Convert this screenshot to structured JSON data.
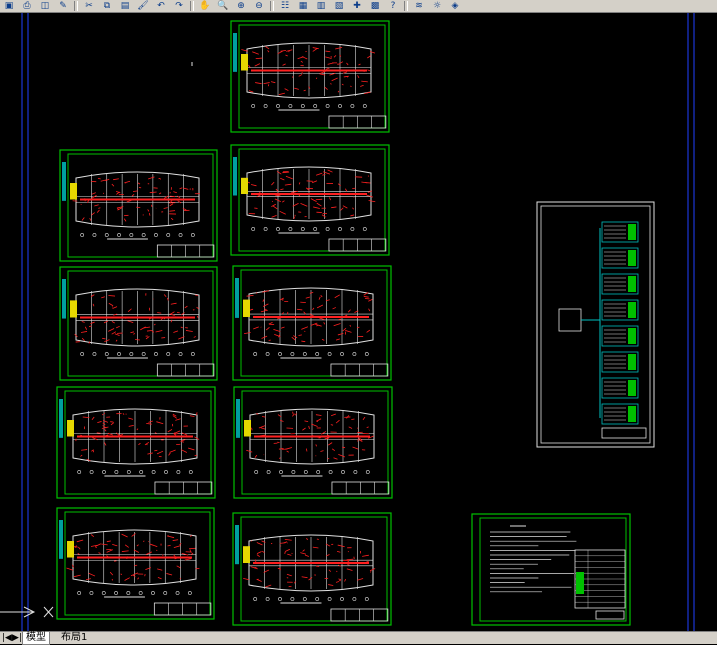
{
  "toolbar": {
    "buttons": [
      {
        "name": "save-icon",
        "glyph": "▣"
      },
      {
        "name": "print-icon",
        "glyph": "⎙"
      },
      {
        "name": "plot-preview-icon",
        "glyph": "◫"
      },
      {
        "name": "publish-icon",
        "glyph": "✎"
      },
      {
        "name": "cut-icon",
        "glyph": "✂"
      },
      {
        "name": "copy-icon",
        "glyph": "⧉"
      },
      {
        "name": "paste-icon",
        "glyph": "▤"
      },
      {
        "name": "match-properties-icon",
        "glyph": "🖌"
      },
      {
        "name": "undo-icon",
        "glyph": "↶"
      },
      {
        "name": "redo-icon",
        "glyph": "↷"
      },
      {
        "name": "pan-icon",
        "glyph": "✋"
      },
      {
        "name": "zoom-realtime-icon",
        "glyph": "🔍"
      },
      {
        "name": "zoom-window-icon",
        "glyph": "⊕"
      },
      {
        "name": "zoom-previous-icon",
        "glyph": "⊖"
      },
      {
        "name": "properties-icon",
        "glyph": "☷"
      },
      {
        "name": "design-center-icon",
        "glyph": "▦"
      },
      {
        "name": "tool-palettes-icon",
        "glyph": "▥"
      },
      {
        "name": "sheet-set-icon",
        "glyph": "▧"
      },
      {
        "name": "markup-icon",
        "glyph": "✚"
      },
      {
        "name": "calculator-icon",
        "glyph": "▩"
      },
      {
        "name": "help-icon",
        "glyph": "?"
      },
      {
        "name": "layer-manager-icon",
        "glyph": "≋"
      },
      {
        "name": "layer-state-icon",
        "glyph": "☼"
      },
      {
        "name": "layer-color-icon",
        "glyph": "◈"
      }
    ]
  },
  "tabs": [
    "模型",
    "布局1"
  ],
  "colors": {
    "frame": "#00c000",
    "drawing": "#ff2020",
    "wall": "#e0e0e0",
    "statusbar": "#d4d0c8"
  }
}
